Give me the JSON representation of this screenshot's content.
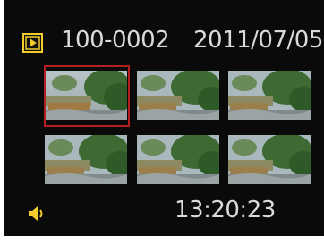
{
  "header": {
    "folder_number": "100-0002",
    "date": "2011/07/05",
    "mode_icon": "play-icon"
  },
  "thumbnails": {
    "count": 6,
    "selected_index": 0
  },
  "footer": {
    "audio_icon": "speaker-icon",
    "time": "13:20:23"
  },
  "colors": {
    "background": "#0a0a0a",
    "text": "#dadada",
    "icon_accent": "#f2cc2c",
    "selection": "#b42020"
  }
}
